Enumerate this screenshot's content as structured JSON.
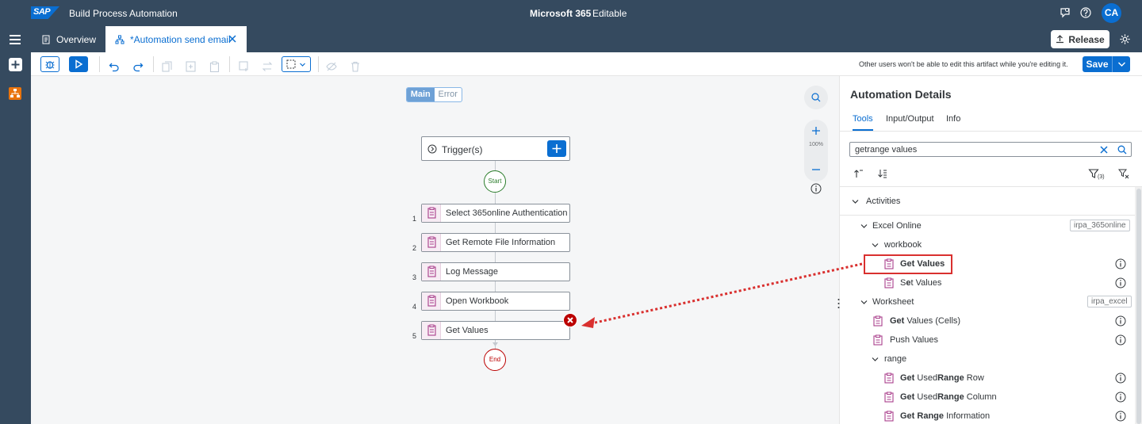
{
  "shell": {
    "logo_text": "SAP",
    "app_title": "Build Process Automation",
    "project_name": "Microsoft 365",
    "project_status": "Editable",
    "avatar_initials": "CA"
  },
  "tabs": [
    {
      "label": "Overview",
      "active": false
    },
    {
      "label": "*Automation send email",
      "active": true
    }
  ],
  "header": {
    "release_label": "Release"
  },
  "toolbar": {
    "lock_note": "Other users won't be able to edit this artifact while you're editing it.",
    "save_label": "Save"
  },
  "canvas": {
    "mode_main": "Main",
    "mode_error": "Error",
    "zoom_level": "100%",
    "trigger_label": "Trigger(s)",
    "start_label": "Start",
    "end_label": "End",
    "steps": [
      {
        "num": "1",
        "label": "Select 365online Authentication"
      },
      {
        "num": "2",
        "label": "Get Remote File Information"
      },
      {
        "num": "3",
        "label": "Log Message"
      },
      {
        "num": "4",
        "label": "Open Workbook"
      },
      {
        "num": "5",
        "label": "Get Values"
      }
    ]
  },
  "panel": {
    "title": "Automation Details",
    "tabs": [
      "Tools",
      "Input/Output",
      "Info"
    ],
    "search_value": "getrange values",
    "filter_count": "(3)",
    "activities_label": "Activities",
    "excel_online": {
      "label": "Excel Online",
      "tag": "irpa_365online"
    },
    "workbook_label": "workbook",
    "get_values": {
      "bold": "Get Values",
      "rest": ""
    },
    "set_values": {
      "pre": "S",
      "bold": "e",
      "rest": "t Values"
    },
    "worksheet": {
      "label": "Worksheet",
      "tag": "irpa_excel"
    },
    "get_values_cells": {
      "bold": "Get",
      "rest": " Values (Cells)"
    },
    "push_values": "Push Values",
    "range_label": "range",
    "used_range_row": {
      "b1": "Get",
      "mid": " Used",
      "b2": "Range",
      "rest": " Row"
    },
    "used_range_col": {
      "b1": "Get",
      "mid": " Used",
      "b2": "Range",
      "rest": " Column"
    },
    "range_info": {
      "b1": "Get",
      "b2": "Range",
      "rest": " Information"
    }
  },
  "colors": {
    "shell_bg": "#354a5f",
    "accent": "#0a6ed1",
    "error": "#bb0000",
    "success": "#2b7d2b",
    "highlight_red": "#d9302f",
    "activity_icon": "#a93e8b"
  }
}
